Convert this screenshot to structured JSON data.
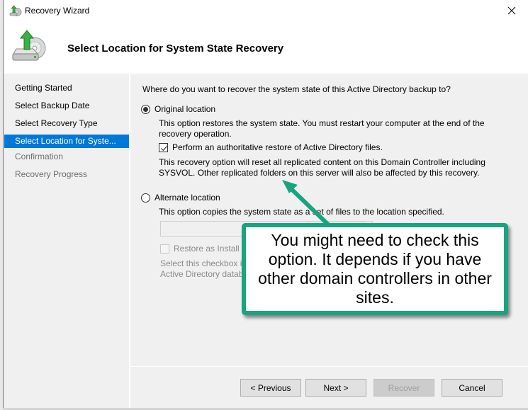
{
  "window": {
    "title": "Recovery Wizard",
    "close_label": "Close"
  },
  "header": {
    "title": "Select Location for System State Recovery"
  },
  "nav": {
    "items": [
      {
        "label": "Getting Started",
        "state": "done"
      },
      {
        "label": "Select Backup Date",
        "state": "done"
      },
      {
        "label": "Select Recovery Type",
        "state": "done"
      },
      {
        "label": "Select Location for Syste...",
        "state": "active"
      },
      {
        "label": "Confirmation",
        "state": "pending"
      },
      {
        "label": "Recovery Progress",
        "state": "pending"
      }
    ]
  },
  "content": {
    "question": "Where do you want to recover the system state of this Active Directory backup to?",
    "original": {
      "label": "Original location",
      "selected": true,
      "description_line1": "This option restores the system state. You must restart your computer at the end of the",
      "description_line2": "recovery operation.",
      "authoritative_checkbox": {
        "label": "Perform an authoritative restore of Active Directory files.",
        "checked": true
      },
      "warning_line1": "This recovery option will reset all replicated content on this Domain Controller including",
      "warning_line2": "SYSVOL. Other replicated folders on this server will also be affected by this recovery."
    },
    "alternate": {
      "label": "Alternate location",
      "selected": false,
      "description": "This option copies the system state as a set of files to the location specified.",
      "path_value": "",
      "ifm_checkbox": {
        "label": "Restore as Install Fr",
        "checked": false,
        "disabled": true
      },
      "ifm_hint_line1": "Select this checkbox if",
      "ifm_hint_line2": "Active Directory datab"
    }
  },
  "buttons": {
    "previous": "< Previous",
    "next": "Next >",
    "recover": "Recover",
    "cancel": "Cancel"
  },
  "annotation": {
    "text": "You might need to check this option. It depends if you have other domain controllers in other sites.",
    "color": "#1aa37f"
  }
}
